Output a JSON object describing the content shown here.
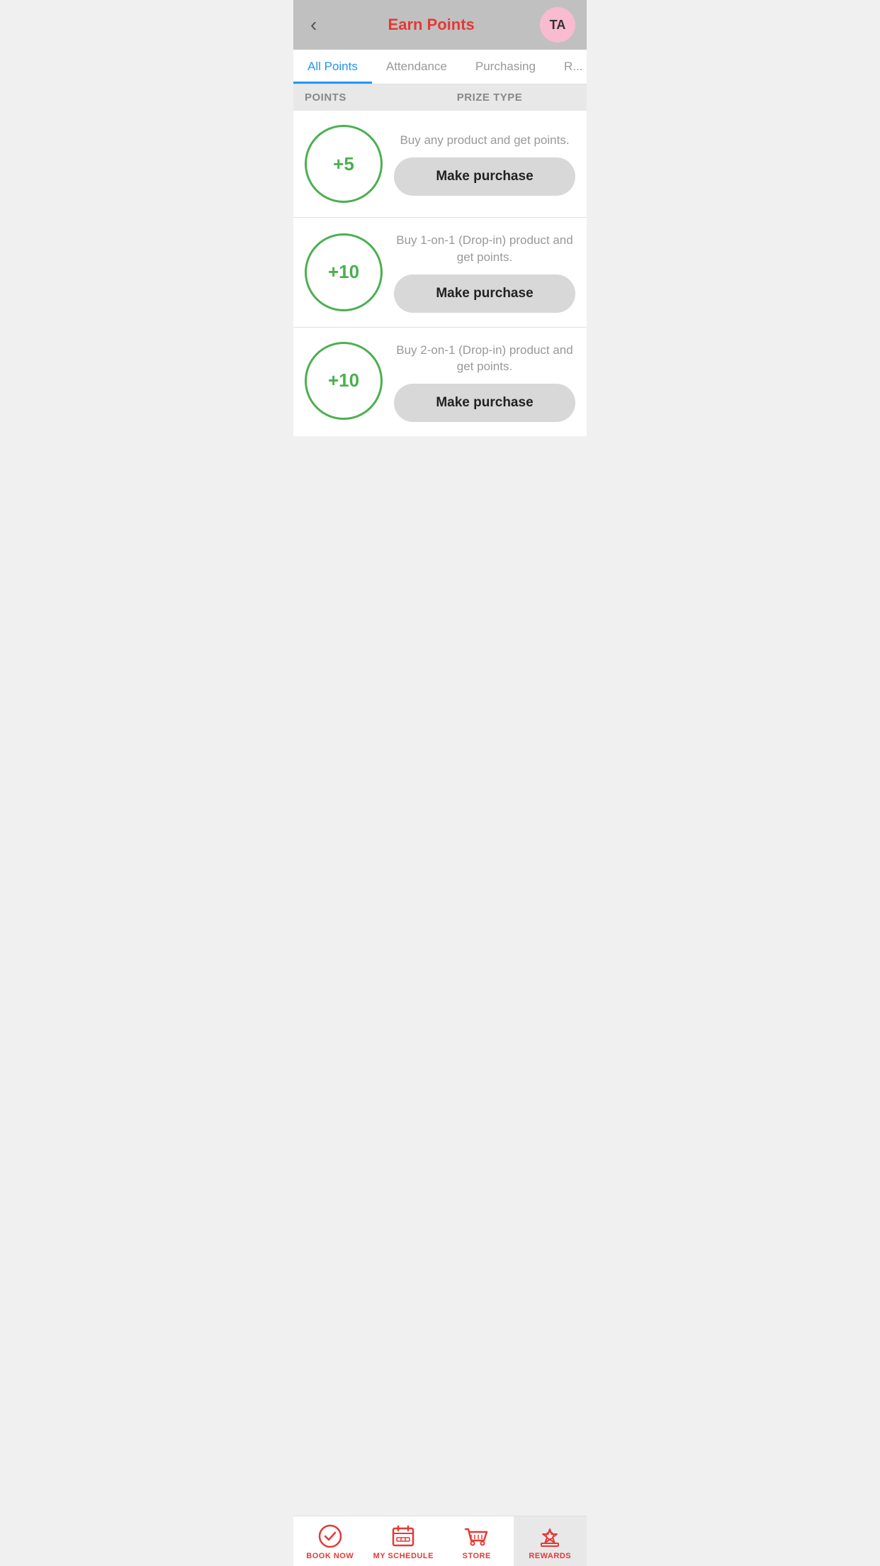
{
  "header": {
    "title": "Earn Points",
    "back_label": "‹",
    "avatar_initials": "TA"
  },
  "tabs": [
    {
      "label": "All Points",
      "active": true
    },
    {
      "label": "Attendance",
      "active": false
    },
    {
      "label": "Purchasing",
      "active": false
    },
    {
      "label": "R...",
      "active": false
    }
  ],
  "columns": {
    "points": "POINTS",
    "prize_type": "PRIZE TYPE"
  },
  "rewards": [
    {
      "points": "+5",
      "description": "Buy any product and get points.",
      "button_label": "Make purchase"
    },
    {
      "points": "+10",
      "description": "Buy 1-on-1 (Drop-in) product and get points.",
      "button_label": "Make purchase"
    },
    {
      "points": "+10",
      "description": "Buy 2-on-1 (Drop-in) product and get points.",
      "button_label": "Make purchase"
    }
  ],
  "bottom_nav": [
    {
      "label": "BOOK NOW",
      "icon": "book-now-icon",
      "active": false
    },
    {
      "label": "MY SCHEDULE",
      "icon": "schedule-icon",
      "active": false
    },
    {
      "label": "STORE",
      "icon": "store-icon",
      "active": false
    },
    {
      "label": "REWARDS",
      "icon": "rewards-icon",
      "active": true
    }
  ],
  "colors": {
    "accent_red": "#e53935",
    "accent_blue": "#2196f3",
    "accent_green": "#4caf50"
  }
}
